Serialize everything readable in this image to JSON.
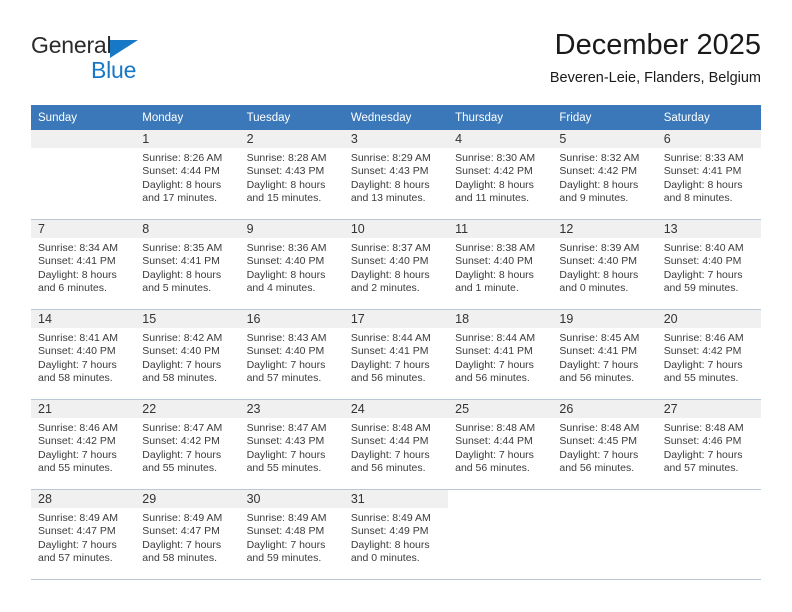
{
  "brand": {
    "name_part1": "General",
    "name_part2": "Blue",
    "triangle_color": "#1878c8",
    "text_color": "#2b2b2b"
  },
  "header": {
    "title": "December 2025",
    "subtitle": "Beveren-Leie, Flanders, Belgium"
  },
  "theme": {
    "header_row_bg": "#3a78ba",
    "header_row_text": "#ffffff",
    "daynum_bg": "#f0f0f0",
    "grid_line": "#b9c7d6"
  },
  "weekday_headers": [
    "Sunday",
    "Monday",
    "Tuesday",
    "Wednesday",
    "Thursday",
    "Friday",
    "Saturday"
  ],
  "weeks": [
    {
      "days": [
        {
          "num": "",
          "sunrise": "",
          "sunset": "",
          "daylight1": "",
          "daylight2": "",
          "empty": true
        },
        {
          "num": "1",
          "sunrise": "Sunrise: 8:26 AM",
          "sunset": "Sunset: 4:44 PM",
          "daylight1": "Daylight: 8 hours",
          "daylight2": "and 17 minutes."
        },
        {
          "num": "2",
          "sunrise": "Sunrise: 8:28 AM",
          "sunset": "Sunset: 4:43 PM",
          "daylight1": "Daylight: 8 hours",
          "daylight2": "and 15 minutes."
        },
        {
          "num": "3",
          "sunrise": "Sunrise: 8:29 AM",
          "sunset": "Sunset: 4:43 PM",
          "daylight1": "Daylight: 8 hours",
          "daylight2": "and 13 minutes."
        },
        {
          "num": "4",
          "sunrise": "Sunrise: 8:30 AM",
          "sunset": "Sunset: 4:42 PM",
          "daylight1": "Daylight: 8 hours",
          "daylight2": "and 11 minutes."
        },
        {
          "num": "5",
          "sunrise": "Sunrise: 8:32 AM",
          "sunset": "Sunset: 4:42 PM",
          "daylight1": "Daylight: 8 hours",
          "daylight2": "and 9 minutes."
        },
        {
          "num": "6",
          "sunrise": "Sunrise: 8:33 AM",
          "sunset": "Sunset: 4:41 PM",
          "daylight1": "Daylight: 8 hours",
          "daylight2": "and 8 minutes."
        }
      ]
    },
    {
      "days": [
        {
          "num": "7",
          "sunrise": "Sunrise: 8:34 AM",
          "sunset": "Sunset: 4:41 PM",
          "daylight1": "Daylight: 8 hours",
          "daylight2": "and 6 minutes."
        },
        {
          "num": "8",
          "sunrise": "Sunrise: 8:35 AM",
          "sunset": "Sunset: 4:41 PM",
          "daylight1": "Daylight: 8 hours",
          "daylight2": "and 5 minutes."
        },
        {
          "num": "9",
          "sunrise": "Sunrise: 8:36 AM",
          "sunset": "Sunset: 4:40 PM",
          "daylight1": "Daylight: 8 hours",
          "daylight2": "and 4 minutes."
        },
        {
          "num": "10",
          "sunrise": "Sunrise: 8:37 AM",
          "sunset": "Sunset: 4:40 PM",
          "daylight1": "Daylight: 8 hours",
          "daylight2": "and 2 minutes."
        },
        {
          "num": "11",
          "sunrise": "Sunrise: 8:38 AM",
          "sunset": "Sunset: 4:40 PM",
          "daylight1": "Daylight: 8 hours",
          "daylight2": "and 1 minute."
        },
        {
          "num": "12",
          "sunrise": "Sunrise: 8:39 AM",
          "sunset": "Sunset: 4:40 PM",
          "daylight1": "Daylight: 8 hours",
          "daylight2": "and 0 minutes."
        },
        {
          "num": "13",
          "sunrise": "Sunrise: 8:40 AM",
          "sunset": "Sunset: 4:40 PM",
          "daylight1": "Daylight: 7 hours",
          "daylight2": "and 59 minutes."
        }
      ]
    },
    {
      "days": [
        {
          "num": "14",
          "sunrise": "Sunrise: 8:41 AM",
          "sunset": "Sunset: 4:40 PM",
          "daylight1": "Daylight: 7 hours",
          "daylight2": "and 58 minutes."
        },
        {
          "num": "15",
          "sunrise": "Sunrise: 8:42 AM",
          "sunset": "Sunset: 4:40 PM",
          "daylight1": "Daylight: 7 hours",
          "daylight2": "and 58 minutes."
        },
        {
          "num": "16",
          "sunrise": "Sunrise: 8:43 AM",
          "sunset": "Sunset: 4:40 PM",
          "daylight1": "Daylight: 7 hours",
          "daylight2": "and 57 minutes."
        },
        {
          "num": "17",
          "sunrise": "Sunrise: 8:44 AM",
          "sunset": "Sunset: 4:41 PM",
          "daylight1": "Daylight: 7 hours",
          "daylight2": "and 56 minutes."
        },
        {
          "num": "18",
          "sunrise": "Sunrise: 8:44 AM",
          "sunset": "Sunset: 4:41 PM",
          "daylight1": "Daylight: 7 hours",
          "daylight2": "and 56 minutes."
        },
        {
          "num": "19",
          "sunrise": "Sunrise: 8:45 AM",
          "sunset": "Sunset: 4:41 PM",
          "daylight1": "Daylight: 7 hours",
          "daylight2": "and 56 minutes."
        },
        {
          "num": "20",
          "sunrise": "Sunrise: 8:46 AM",
          "sunset": "Sunset: 4:42 PM",
          "daylight1": "Daylight: 7 hours",
          "daylight2": "and 55 minutes."
        }
      ]
    },
    {
      "days": [
        {
          "num": "21",
          "sunrise": "Sunrise: 8:46 AM",
          "sunset": "Sunset: 4:42 PM",
          "daylight1": "Daylight: 7 hours",
          "daylight2": "and 55 minutes."
        },
        {
          "num": "22",
          "sunrise": "Sunrise: 8:47 AM",
          "sunset": "Sunset: 4:42 PM",
          "daylight1": "Daylight: 7 hours",
          "daylight2": "and 55 minutes."
        },
        {
          "num": "23",
          "sunrise": "Sunrise: 8:47 AM",
          "sunset": "Sunset: 4:43 PM",
          "daylight1": "Daylight: 7 hours",
          "daylight2": "and 55 minutes."
        },
        {
          "num": "24",
          "sunrise": "Sunrise: 8:48 AM",
          "sunset": "Sunset: 4:44 PM",
          "daylight1": "Daylight: 7 hours",
          "daylight2": "and 56 minutes."
        },
        {
          "num": "25",
          "sunrise": "Sunrise: 8:48 AM",
          "sunset": "Sunset: 4:44 PM",
          "daylight1": "Daylight: 7 hours",
          "daylight2": "and 56 minutes."
        },
        {
          "num": "26",
          "sunrise": "Sunrise: 8:48 AM",
          "sunset": "Sunset: 4:45 PM",
          "daylight1": "Daylight: 7 hours",
          "daylight2": "and 56 minutes."
        },
        {
          "num": "27",
          "sunrise": "Sunrise: 8:48 AM",
          "sunset": "Sunset: 4:46 PM",
          "daylight1": "Daylight: 7 hours",
          "daylight2": "and 57 minutes."
        }
      ]
    },
    {
      "days": [
        {
          "num": "28",
          "sunrise": "Sunrise: 8:49 AM",
          "sunset": "Sunset: 4:47 PM",
          "daylight1": "Daylight: 7 hours",
          "daylight2": "and 57 minutes."
        },
        {
          "num": "29",
          "sunrise": "Sunrise: 8:49 AM",
          "sunset": "Sunset: 4:47 PM",
          "daylight1": "Daylight: 7 hours",
          "daylight2": "and 58 minutes."
        },
        {
          "num": "30",
          "sunrise": "Sunrise: 8:49 AM",
          "sunset": "Sunset: 4:48 PM",
          "daylight1": "Daylight: 7 hours",
          "daylight2": "and 59 minutes."
        },
        {
          "num": "31",
          "sunrise": "Sunrise: 8:49 AM",
          "sunset": "Sunset: 4:49 PM",
          "daylight1": "Daylight: 8 hours",
          "daylight2": "and 0 minutes."
        },
        {
          "num": "",
          "sunrise": "",
          "sunset": "",
          "daylight1": "",
          "daylight2": "",
          "blank": true
        },
        {
          "num": "",
          "sunrise": "",
          "sunset": "",
          "daylight1": "",
          "daylight2": "",
          "blank": true
        },
        {
          "num": "",
          "sunrise": "",
          "sunset": "",
          "daylight1": "",
          "daylight2": "",
          "blank": true
        }
      ]
    }
  ]
}
